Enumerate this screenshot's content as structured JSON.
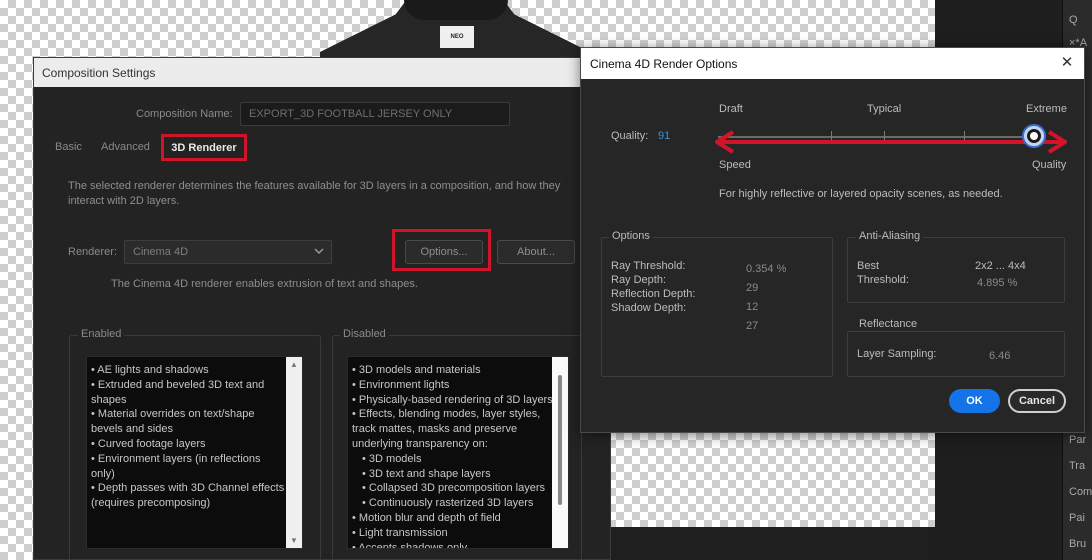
{
  "right_panel": {
    "items": [
      "Par",
      "Tra",
      "Com",
      "Pai",
      "Bru"
    ],
    "top_glyphs": [
      "Q",
      "×*A",
      "•",
      "e",
      "•"
    ]
  },
  "jersey_tag": "NEO",
  "comp": {
    "title": "Composition Settings",
    "name_label": "Composition Name:",
    "name_value": "EXPORT_3D FOOTBALL JERSEY ONLY",
    "tabs": [
      "Basic",
      "Advanced",
      "3D Renderer"
    ],
    "description": "The selected renderer determines the features available for 3D layers in a composition, and how they interact with 2D layers.",
    "renderer_label": "Renderer:",
    "renderer_value": "Cinema 4D",
    "options_label": "Options...",
    "about_label": "About...",
    "renderer_note": "The Cinema 4D renderer enables extrusion of text and shapes.",
    "enabled_label": "Enabled",
    "disabled_label": "Disabled",
    "enabled_items": [
      "• AE lights and shadows",
      "• Extruded and beveled 3D text and",
      "shapes",
      "• Material overrides on text/shape",
      "bevels and sides",
      "• Curved footage layers",
      "• Environment layers (in reflections",
      "only)",
      "• Depth passes with 3D Channel effects",
      "(requires precomposing)"
    ],
    "disabled_items": [
      "• 3D models and materials",
      "• Environment lights",
      "• Physically-based rendering of 3D layers",
      "• Effects, blending modes, layer styles,",
      "track mattes, masks and preserve",
      "underlying transparency on:",
      "• 3D models",
      "• 3D text and shape layers",
      "• Collapsed 3D precomposition layers",
      "• Continuously rasterized 3D layers",
      "• Motion blur and depth of field",
      "• Light transmission",
      "• Accepts shadows only"
    ]
  },
  "c4d": {
    "title": "Cinema 4D Render Options",
    "close_glyph": "✕",
    "quality_label": "Quality:",
    "quality_value": "91",
    "quality_fraction": 0.91,
    "slider_labels": {
      "draft": "Draft",
      "typical": "Typical",
      "extreme": "Extreme",
      "speed": "Speed",
      "quality": "Quality"
    },
    "hint": "For highly reflective or layered opacity scenes, as needed.",
    "options_title": "Options",
    "options_labels": [
      "Ray Threshold:",
      "Ray Depth:",
      "Reflection Depth:",
      "Shadow Depth:"
    ],
    "options_values": [
      "0.354 %",
      "29",
      "12",
      "27"
    ],
    "aa_title": "Anti-Aliasing",
    "aa_best_label": "Best",
    "aa_best_value": "2x2 ... 4x4",
    "aa_threshold_label": "Threshold:",
    "aa_threshold_value": "4.895 %",
    "refl_title": "Reflectance",
    "layer_sampling_label": "Layer Sampling:",
    "layer_sampling_value": "6.46",
    "ok_label": "OK",
    "cancel_label": "Cancel"
  },
  "colors": {
    "highlight_red": "#d2142a",
    "ok_blue": "#1473e6",
    "quality_blue": "#3b8ee0"
  }
}
